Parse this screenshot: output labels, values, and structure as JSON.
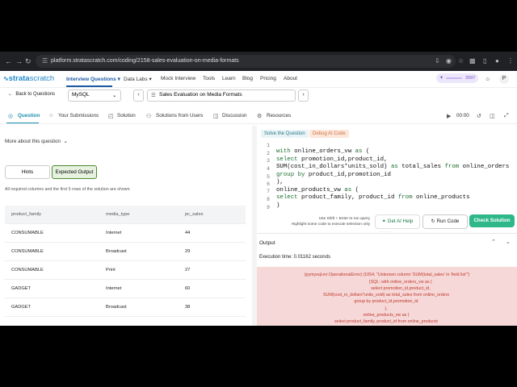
{
  "browser": {
    "url": "platform.stratascratch.com/coding/2158-sales-evaluation-on-media-formats"
  },
  "header": {
    "logo_prefix": "strata",
    "logo_suffix": "scratch",
    "nav": [
      "Interview Questions",
      "Data Labs",
      "Mock Interview",
      "Tools",
      "Learn",
      "Blog",
      "Pricing",
      "About"
    ],
    "points": "3997",
    "avatar": "P"
  },
  "qbar": {
    "back_label": "Back to Questions",
    "language": "MySQL",
    "question_title": "Sales Evaluation on Media Formats"
  },
  "tabs": [
    "Question",
    "Your Submissions",
    "Solution",
    "Solutions from Users",
    "Discussion",
    "Resources"
  ],
  "timer": "00:00",
  "left": {
    "more_about": "More about this question",
    "hints_label": "Hints",
    "expected_output_label": "Expected Output",
    "note": "All required columns and the first 5 rows of the solution are shown",
    "columns": [
      "product_family",
      "media_type",
      "pc_sales"
    ],
    "rows": [
      [
        "CONSUMABLE",
        "Internet",
        "44"
      ],
      [
        "CONSUMABLE",
        "Broadcast",
        "29"
      ],
      [
        "CONSUMABLE",
        "Print",
        "27"
      ],
      [
        "GADGET",
        "Internet",
        "60"
      ],
      [
        "GADGET",
        "Broadcast",
        "38"
      ]
    ]
  },
  "editor": {
    "tab_solve": "Solve the Question",
    "tab_debug": "Debug AI Code",
    "line_numbers": [
      "1",
      "2",
      "3",
      "4",
      "5",
      "6",
      "7",
      "8",
      "9"
    ],
    "run_note_1": "Use Shift + Enter to run query",
    "run_note_2": "Highlight some code to execute selection only",
    "ai_help_label": "Get AI Help",
    "run_label": "Run Code",
    "check_label": "Check Solution"
  },
  "output": {
    "title": "Output",
    "exec_time": "Execution time: 0.01162 seconds",
    "error_lines": [
      "(pymysql.err.OperationalError) (1054, \"Unknown column 'SUM(total_sales' in 'field list'\")",
      "[SQL: with online_orders_vw as (",
      "select promotion_id,product_id,",
      "SUM(cost_in_dollars*units_sold) as total_sales from online_orders",
      "group by product_id,promotion_id",
      "),",
      "online_products_vw as (",
      "select product_family, product_id from online_products"
    ]
  }
}
